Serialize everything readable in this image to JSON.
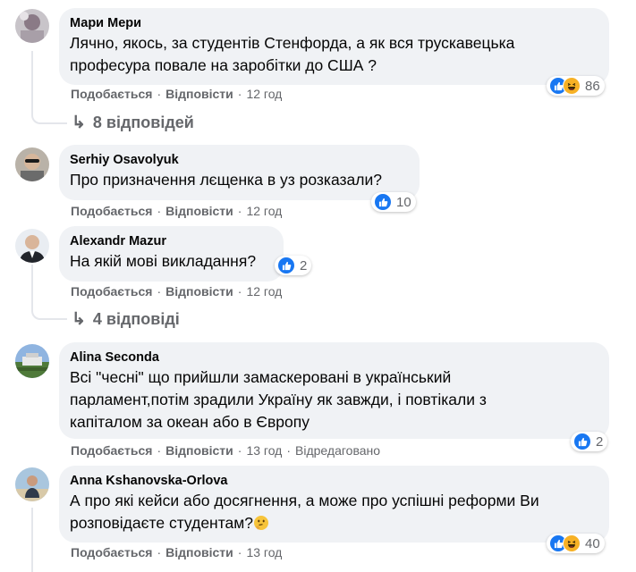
{
  "comments": [
    {
      "author": "Мари Мери",
      "lines": [
        "Лячно, якось, за студентів Стенфорда, а як вся трускавецька",
        "професура повале на заробітки до США ?"
      ],
      "reactions": [
        "like-icon",
        "haha-icon"
      ],
      "reaction_count": "86",
      "like_label": "Подобається",
      "reply_label": "Відповісти",
      "time": "12 год",
      "replies_label": "8 відповідей"
    },
    {
      "author": "Serhiy Osavolyuk",
      "lines": [
        "Про призначення лєщенка в уз розказали?"
      ],
      "reactions": [
        "like-icon"
      ],
      "reaction_count": "10",
      "like_label": "Подобається",
      "reply_label": "Відповісти",
      "time": "12 год"
    },
    {
      "author": "Alexandr Mazur",
      "lines": [
        "На якій мові викладання?"
      ],
      "reactions": [
        "like-icon"
      ],
      "reaction_count": "2",
      "like_label": "Подобається",
      "reply_label": "Відповісти",
      "time": "12 год",
      "replies_label": "4 відповіді"
    },
    {
      "author": "Alina Seconda",
      "lines": [
        "Всі \"чесні\" що прийшли замаскеровані в український",
        "парламент,потім зрадили Україну як завжди, і повтікали з",
        "капіталом за океан або в Європу"
      ],
      "reactions": [
        "like-icon"
      ],
      "reaction_count": "2",
      "like_label": "Подобається",
      "reply_label": "Відповісти",
      "time": "13 год",
      "edited_label": "Відредаговано"
    },
    {
      "author": "Anna Kshanovska-Orlova",
      "lines": [
        "А про які кейси або досягнення, а може про успішні реформи Ви",
        "розповідаєте студентам?"
      ],
      "trailing_emoji": "thinking-face-icon",
      "reactions": [
        "like-icon",
        "haha-icon"
      ],
      "reaction_count": "40",
      "like_label": "Подобається",
      "reply_label": "Відповісти",
      "time": "13 год"
    }
  ],
  "colors": {
    "like": "#1877f2",
    "haha": "#f7b125",
    "secondary_text": "#65676b",
    "bubble": "#f0f2f5"
  }
}
